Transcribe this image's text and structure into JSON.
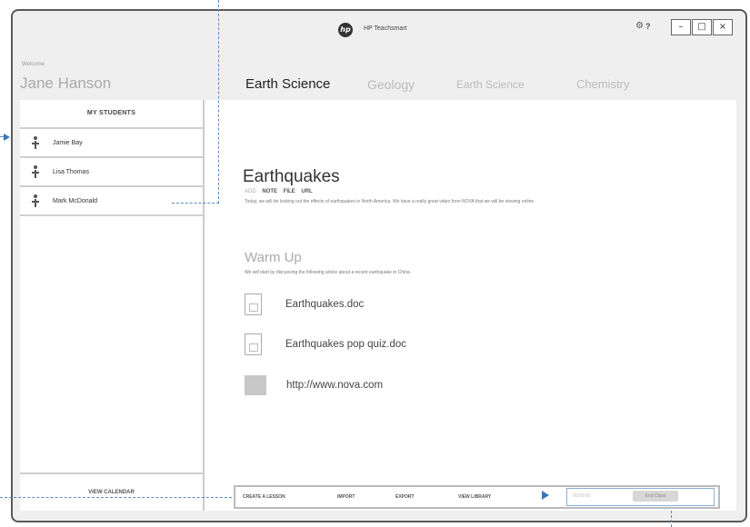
{
  "app": {
    "title": "HP Teachsmart",
    "logo_text": "hp",
    "settings_icon": "gear-icon",
    "help_text": "?",
    "window_buttons": {
      "minimize": "–",
      "maximize": "□",
      "close": "×"
    }
  },
  "user": {
    "welcome_label": "Welcome",
    "name": "Jane Hanson"
  },
  "tabs": [
    {
      "label": "Earth Science",
      "active": true
    },
    {
      "label": "Geology",
      "active": false
    },
    {
      "label": "Earth Science",
      "active": false
    },
    {
      "label": "Chemistry",
      "active": false
    }
  ],
  "sidebar": {
    "header": "MY STUDENTS",
    "students": [
      {
        "name": "Jamie Bay"
      },
      {
        "name": "Lisa Thomas"
      },
      {
        "name": "Mark McDonald"
      }
    ],
    "footer_link": "VIEW CALENDAR"
  },
  "lesson": {
    "title": "Earthquakes",
    "add_label": "ADD",
    "add_options": [
      "NOTE",
      "FILE",
      "URL"
    ],
    "description": "Today, we will be looking out the effects of earthquakes in North America. We have a really great video from NOVA that we will be viewing online."
  },
  "section": {
    "title": "Warm Up",
    "description": "We will start by discussing the following article about a recent earthquake in China."
  },
  "resources": [
    {
      "type": "doc",
      "label": "Earthquakes.doc"
    },
    {
      "type": "doc",
      "label": "Earthquakes pop quiz.doc"
    },
    {
      "type": "link",
      "label": "http://www.nova.com"
    }
  ],
  "toolbar": {
    "create": "CREATE A LESSON",
    "import": "IMPORT",
    "export": "EXPORT",
    "library": "VIEW LIBRARY",
    "timer": "00:00:00",
    "end_class": "End Class"
  },
  "colors": {
    "accent": "#3a78bd",
    "border": "#5a5a5a"
  }
}
